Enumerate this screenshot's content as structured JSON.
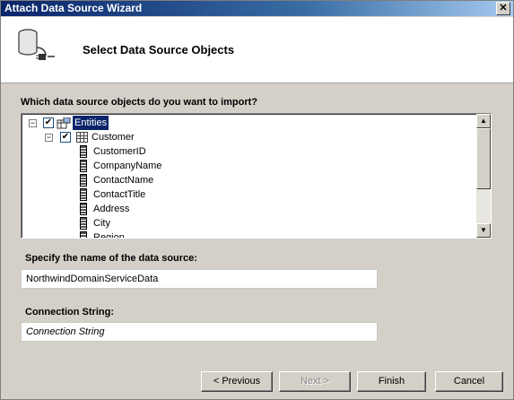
{
  "window": {
    "title": "Attach Data Source Wizard",
    "close_glyph": "✕"
  },
  "header": {
    "title": "Select Data Source Objects",
    "icon": "database-plug-icon"
  },
  "tree_section": {
    "label": "Which data source objects do you want to import?",
    "root": {
      "label": "Entities",
      "checked": true,
      "expanded": true
    },
    "entity": {
      "label": "Customer",
      "checked": true,
      "expanded": true
    },
    "fields": [
      "CustomerID",
      "CompanyName",
      "ContactName",
      "ContactTitle",
      "Address",
      "City",
      "Region"
    ]
  },
  "name_section": {
    "label": "Specify the name of the data source:",
    "value": "NorthwindDomainServiceData"
  },
  "connection_section": {
    "label": "Connection String:",
    "placeholder": "Connection String"
  },
  "buttons": {
    "previous": "< Previous",
    "next": "Next >",
    "finish": "Finish",
    "cancel": "Cancel"
  }
}
